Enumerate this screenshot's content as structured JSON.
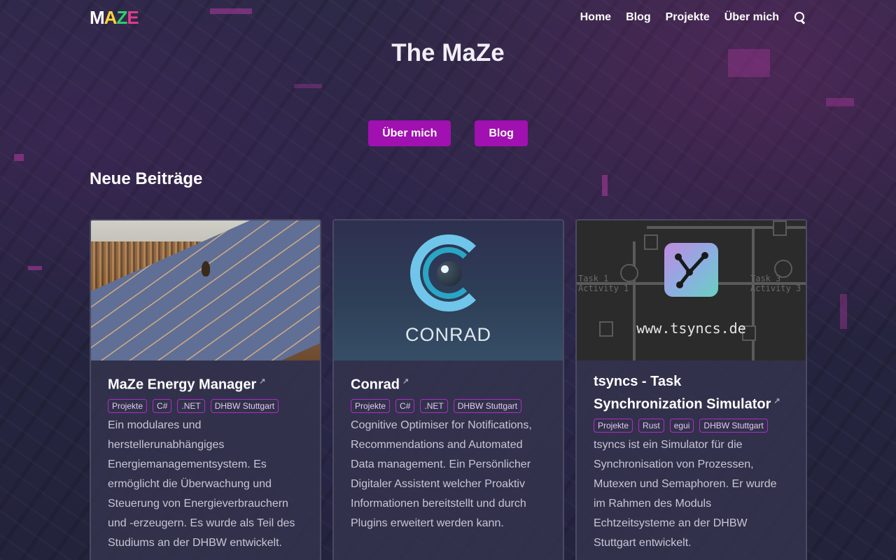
{
  "header": {
    "logo_text": "MAZE",
    "nav": [
      "Home",
      "Blog",
      "Projekte",
      "Über mich"
    ]
  },
  "hero": {
    "title": "The MaZe",
    "buttons": [
      "Über mich",
      "Blog"
    ]
  },
  "section_title": "Neue Beiträge",
  "cards": [
    {
      "title": "MaZe Energy Manager",
      "tags": [
        "Projekte",
        "C#",
        ".NET",
        "DHBW Stuttgart"
      ],
      "text": "Ein modulares und herstellerunabhängiges Energiemanagementsystem. Es ermöglicht die Überwachung und Steuerung von Energieverbrauchern und -erzeugern. Es wurde als Teil des Studiums an der DHBW entwickelt."
    },
    {
      "title": "Conrad",
      "image_word": "CONRAD",
      "tags": [
        "Projekte",
        "C#",
        ".NET",
        "DHBW Stuttgart"
      ],
      "text": "Cognitive Optimiser for Notifications, Recommendations and Automated Data management. Ein Persönlicher Digitaler Assistent welcher Proaktiv Informationen bereitstellt und durch Plugins erweitert werden kann."
    },
    {
      "title": "tsyncs - Task Synchronization Simulator",
      "image_task1": "Task 1",
      "image_activity1": "Activity 1",
      "image_task3": "Task 3",
      "image_activity3": "Activity 3",
      "image_url": "www.tsyncs.de",
      "tags": [
        "Projekte",
        "Rust",
        "egui",
        "DHBW Stuttgart"
      ],
      "text": "tsyncs ist ein Simulator für die Synchronisation von Prozessen, Mutexen und Semaphoren. Er wurde im Rahmen des Moduls Echtzeitsysteme an der DHBW Stuttgart entwickelt."
    }
  ],
  "colors": {
    "accent": "#a110b0",
    "tag_border": "#b22ac8",
    "background": "#262540"
  }
}
